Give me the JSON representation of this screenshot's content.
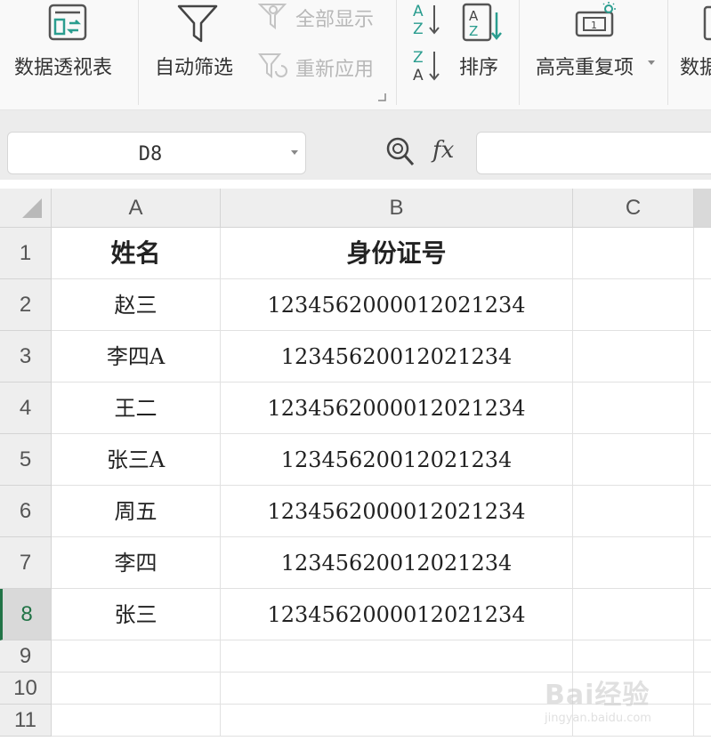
{
  "ribbon": {
    "pivot_table": "数据透视表",
    "auto_filter": "自动筛选",
    "show_all": "全部显示",
    "reapply": "重新应用",
    "sort": "排序",
    "highlight_duplicates": "高亮重复项",
    "data_partial": "数据"
  },
  "formula_bar": {
    "name_box": "D8",
    "fx": "fx",
    "formula": ""
  },
  "columns": [
    "A",
    "B",
    "C"
  ],
  "rows": [
    {
      "num": "1",
      "name": "姓名",
      "id": "身份证号"
    },
    {
      "num": "2",
      "name": "赵三",
      "id": "123456200001202​1234"
    },
    {
      "num": "3",
      "name": "李四A",
      "id": "1234562001202​1234"
    },
    {
      "num": "4",
      "name": "王二",
      "id": "123456200001202​1234"
    },
    {
      "num": "5",
      "name": "张三A",
      "id": "1234562001202​1234"
    },
    {
      "num": "6",
      "name": "周五",
      "id": "123456200001202​1234"
    },
    {
      "num": "7",
      "name": "李四",
      "id": "1234562001202​1234"
    },
    {
      "num": "8",
      "name": "张三",
      "id": "123456200001202​1234"
    },
    {
      "num": "9",
      "name": "",
      "id": ""
    },
    {
      "num": "10",
      "name": "",
      "id": ""
    },
    {
      "num": "11",
      "name": "",
      "id": ""
    }
  ],
  "watermark": {
    "brand": "Bai经验",
    "url": "jingyan.baidu.com"
  },
  "colors": {
    "accent": "#217346",
    "header_bg": "#eeeeee"
  }
}
